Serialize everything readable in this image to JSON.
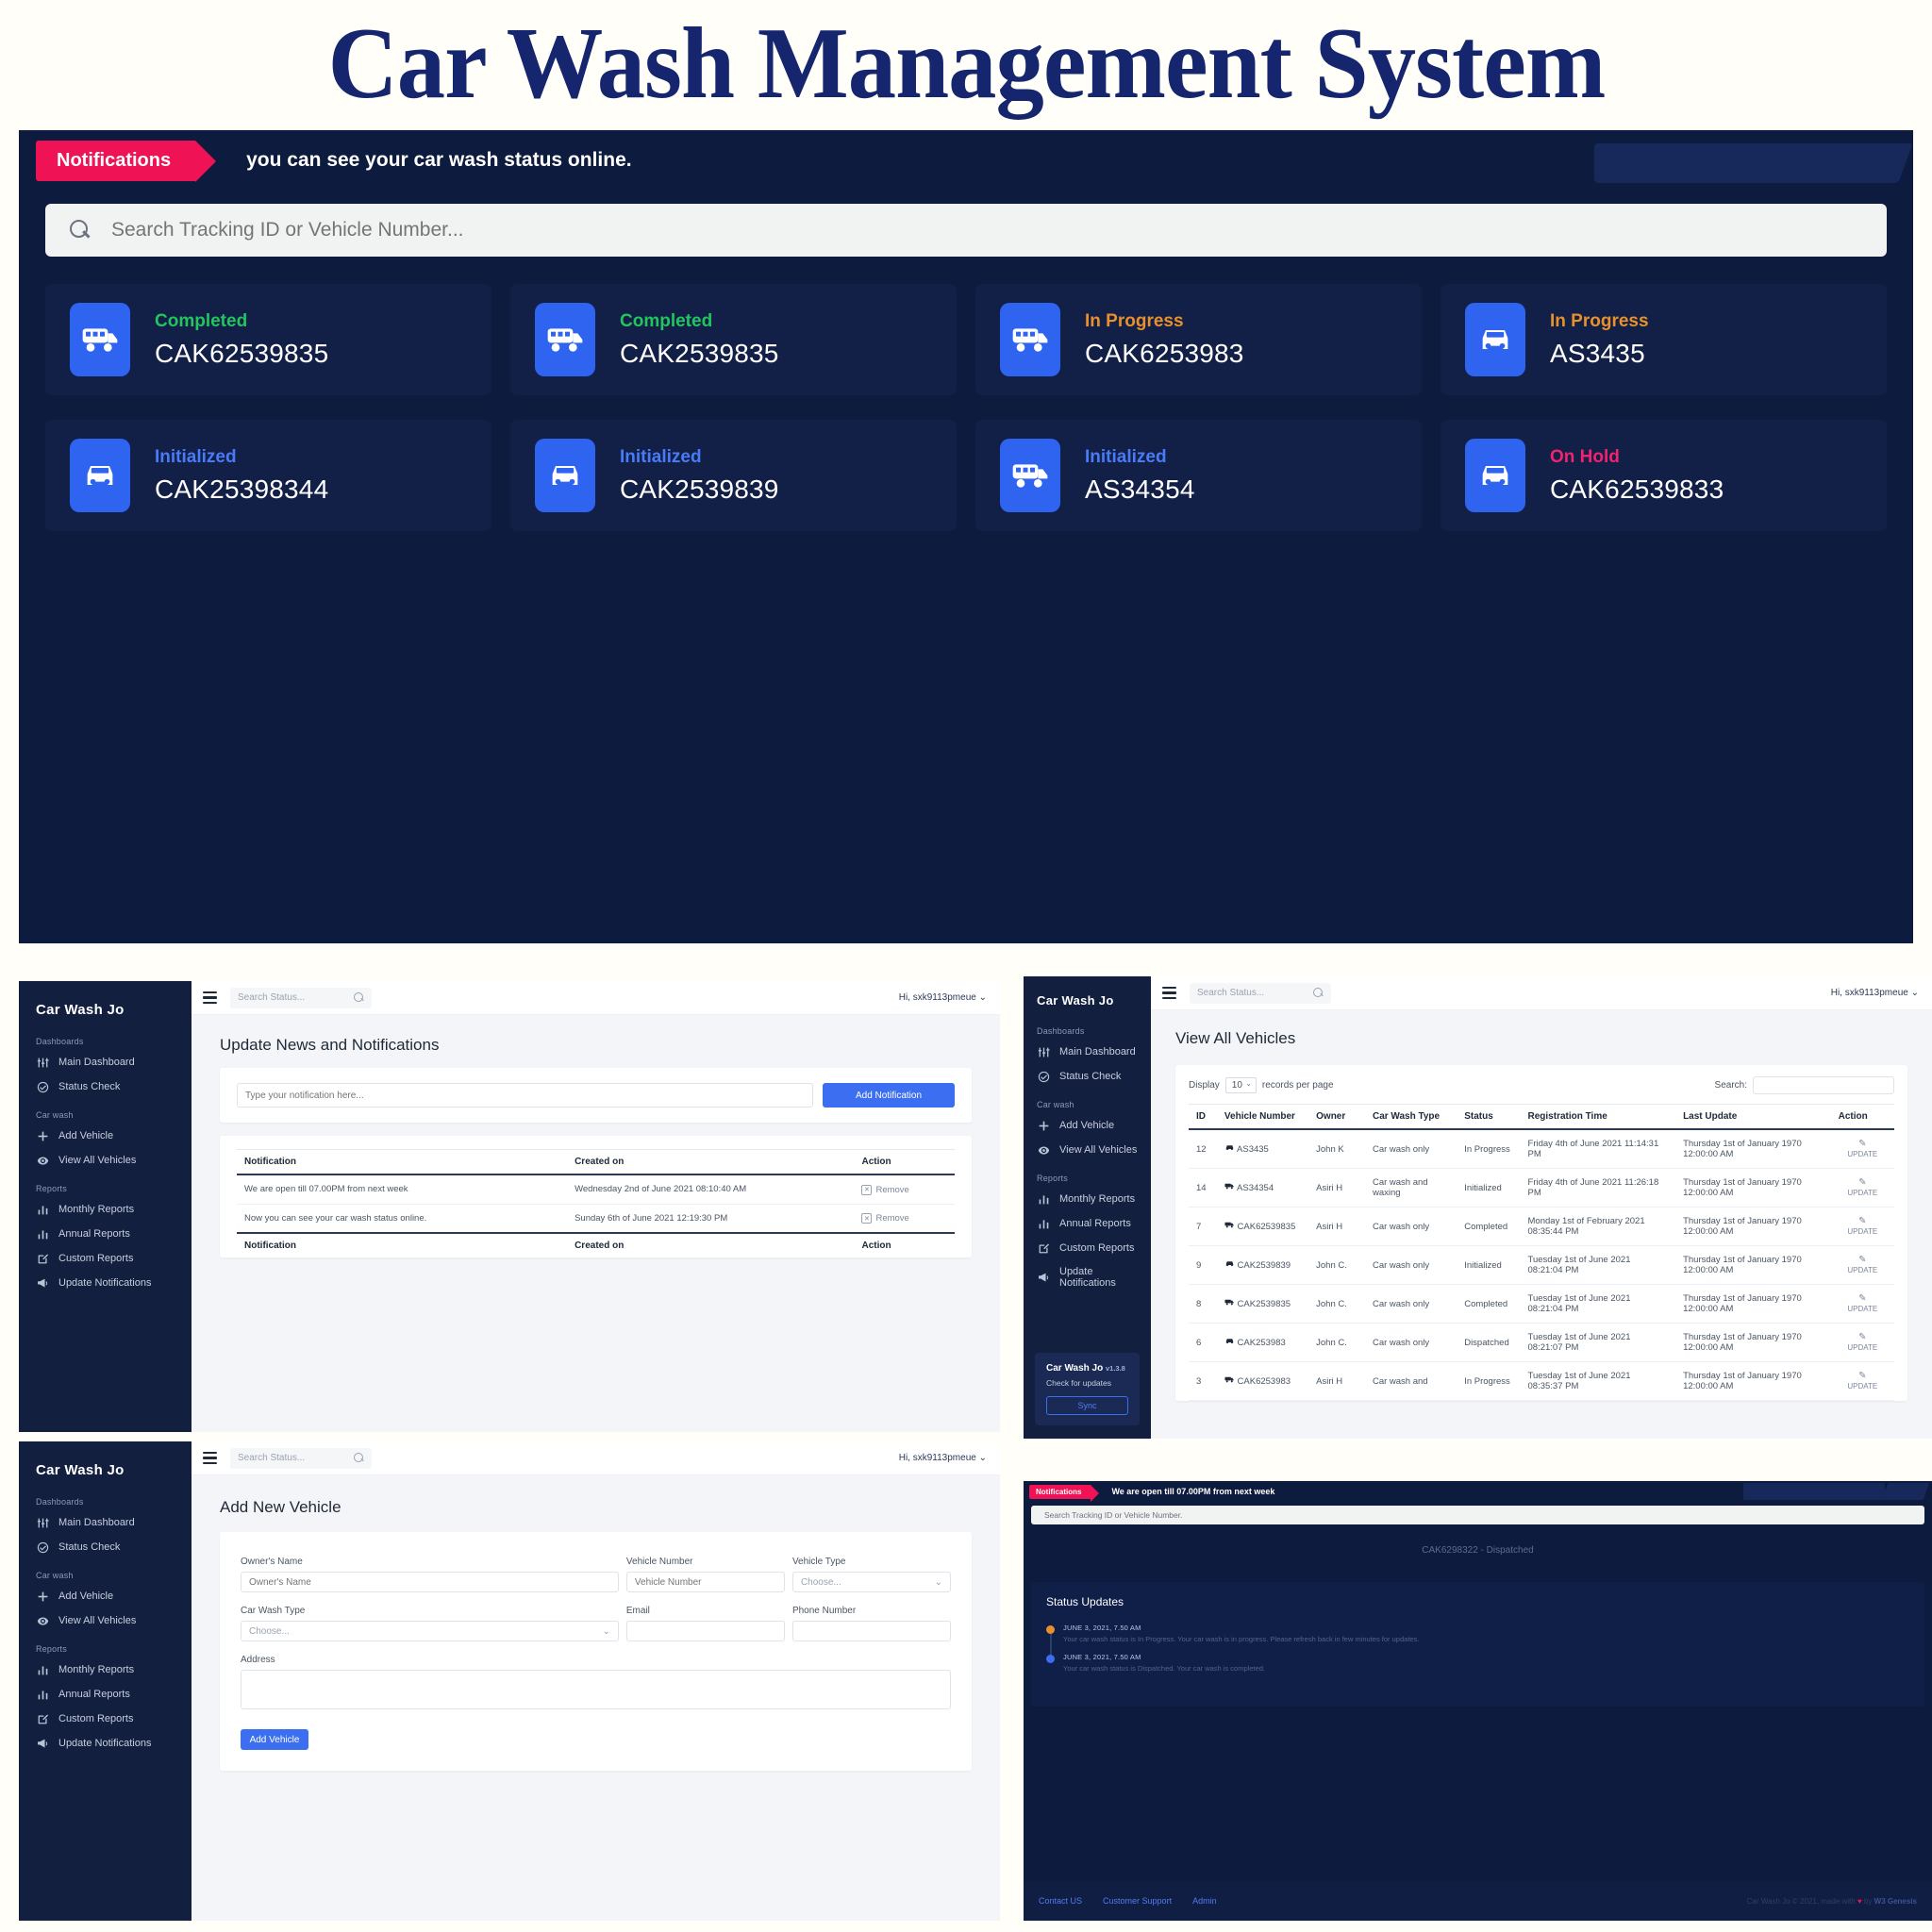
{
  "page_title": "Car Wash Management System",
  "hero": {
    "notification_tag": "Notifications",
    "notification_text": "you can see your car wash status online.",
    "search_placeholder": "Search Tracking ID or Vehicle Number...",
    "cards": [
      {
        "status": "Completed",
        "status_class": "s-completed",
        "tracking_id": "CAK62539835",
        "icon": "van-icon"
      },
      {
        "status": "Completed",
        "status_class": "s-completed",
        "tracking_id": "CAK2539835",
        "icon": "van-icon"
      },
      {
        "status": "In Progress",
        "status_class": "s-inprogress",
        "tracking_id": "CAK6253983",
        "icon": "van-icon"
      },
      {
        "status": "In Progress",
        "status_class": "s-inprogress",
        "tracking_id": "AS3435",
        "icon": "car-icon"
      },
      {
        "status": "Initialized",
        "status_class": "s-initialized",
        "tracking_id": "CAK25398344",
        "icon": "car-icon"
      },
      {
        "status": "Initialized",
        "status_class": "s-initialized",
        "tracking_id": "CAK2539839",
        "icon": "car-icon"
      },
      {
        "status": "Initialized",
        "status_class": "s-initialized",
        "tracking_id": "AS34354",
        "icon": "van-icon"
      },
      {
        "status": "On Hold",
        "status_class": "s-onhold",
        "tracking_id": "CAK62539833",
        "icon": "car-icon"
      }
    ]
  },
  "sidebar": {
    "brand": "Car Wash Jo",
    "groups": [
      {
        "label": "Dashboards",
        "items": [
          {
            "label": "Main Dashboard",
            "icon": "sliders-icon"
          },
          {
            "label": "Status Check",
            "icon": "check-circle-icon"
          }
        ]
      },
      {
        "label": "Car wash",
        "items": [
          {
            "label": "Add Vehicle",
            "icon": "plus-icon"
          },
          {
            "label": "View All Vehicles",
            "icon": "eye-icon"
          }
        ]
      },
      {
        "label": "Reports",
        "items": [
          {
            "label": "Monthly Reports",
            "icon": "bar-chart-icon"
          },
          {
            "label": "Annual Reports",
            "icon": "bar-chart-icon"
          },
          {
            "label": "Custom Reports",
            "icon": "edit-square-icon"
          },
          {
            "label": "Update Notifications",
            "icon": "megaphone-icon"
          }
        ]
      }
    ],
    "version_card": {
      "name": "Car Wash Jo",
      "version": "v1.3.8",
      "subtitle": "Check for updates",
      "sync_label": "Sync"
    }
  },
  "topbar": {
    "search_placeholder": "Search Status...",
    "user_greeting": "Hi, sxk9113pmeue"
  },
  "notifications_page": {
    "title": "Update News and Notifications",
    "input_placeholder": "Type your notification here...",
    "add_button": "Add Notification",
    "columns": [
      "Notification",
      "Created on",
      "Action"
    ],
    "rows": [
      {
        "notification": "We are open till 07.00PM from next week",
        "created_on": "Wednesday 2nd of June 2021 08:10:40 AM",
        "action": "Remove"
      },
      {
        "notification": "Now you can see your car wash status online.",
        "created_on": "Sunday 6th of June 2021 12:19:30 PM",
        "action": "Remove"
      }
    ]
  },
  "vehicles_page": {
    "title": "View All Vehicles",
    "display_label": "Display",
    "records_value": "10",
    "records_label": "records per page",
    "search_label": "Search:",
    "search_value": "",
    "columns": [
      "ID",
      "Vehicle Number",
      "Owner",
      "Car Wash Type",
      "Status",
      "Registration Time",
      "Last Update",
      "Action"
    ],
    "rows": [
      {
        "id": "12",
        "vehicle_icon": "car-icon",
        "vehicle_number": "AS3435",
        "owner": "John K",
        "wash_type": "Car wash only",
        "status": "In Progress",
        "status_class": "s-inprogress",
        "registration": "Friday 4th of June 2021 11:14:31 PM",
        "last_update": "Thursday 1st of January 1970 12:00:00 AM",
        "action": "UPDATE"
      },
      {
        "id": "14",
        "vehicle_icon": "van-icon",
        "vehicle_number": "AS34354",
        "owner": "Asiri H",
        "wash_type": "Car wash and waxing",
        "status": "Initialized",
        "status_class": "s-initialized",
        "registration": "Friday 4th of June 2021 11:26:18 PM",
        "last_update": "Thursday 1st of January 1970 12:00:00 AM",
        "action": "UPDATE"
      },
      {
        "id": "7",
        "vehicle_icon": "van-icon",
        "vehicle_number": "CAK62539835",
        "owner": "Asiri H",
        "wash_type": "Car wash only",
        "status": "Completed",
        "status_class": "s-completed",
        "registration": "Monday 1st of February 2021 08:35:44 PM",
        "last_update": "Thursday 1st of January 1970 12:00:00 AM",
        "action": "UPDATE"
      },
      {
        "id": "9",
        "vehicle_icon": "car-icon",
        "vehicle_number": "CAK2539839",
        "owner": "John C.",
        "wash_type": "Car wash only",
        "status": "Initialized",
        "status_class": "s-initialized",
        "registration": "Tuesday 1st of June 2021 08:21:04 PM",
        "last_update": "Thursday 1st of January 1970 12:00:00 AM",
        "action": "UPDATE"
      },
      {
        "id": "8",
        "vehicle_icon": "van-icon",
        "vehicle_number": "CAK2539835",
        "owner": "John C.",
        "wash_type": "Car wash only",
        "status": "Completed",
        "status_class": "s-completed",
        "registration": "Tuesday 1st of June 2021 08:21:04 PM",
        "last_update": "Thursday 1st of January 1970 12:00:00 AM",
        "action": "UPDATE"
      },
      {
        "id": "6",
        "vehicle_icon": "car-icon",
        "vehicle_number": "CAK253983",
        "owner": "John C.",
        "wash_type": "Car wash only",
        "status": "Dispatched",
        "status_class": "s-dispatched",
        "registration": "Tuesday 1st of June 2021 08:21:07 PM",
        "last_update": "Thursday 1st of January 1970 12:00:00 AM",
        "action": "UPDATE"
      },
      {
        "id": "3",
        "vehicle_icon": "van-icon",
        "vehicle_number": "CAK6253983",
        "owner": "Asiri H",
        "wash_type": "Car wash and",
        "status": "In Progress",
        "status_class": "s-inprogress",
        "registration": "Tuesday 1st of June 2021 08:35:37 PM",
        "last_update": "Thursday 1st of January 1970 12:00:00 AM",
        "action": "UPDATE"
      }
    ]
  },
  "add_vehicle_page": {
    "title": "Add New Vehicle",
    "fields": {
      "owner_name_label": "Owner's Name",
      "owner_name_placeholder": "Owner's Name",
      "vehicle_number_label": "Vehicle Number",
      "vehicle_number_placeholder": "Vehicle Number",
      "vehicle_type_label": "Vehicle Type",
      "vehicle_type_value": "Choose...",
      "car_wash_type_label": "Car Wash Type",
      "car_wash_type_value": "Choose...",
      "email_label": "Email",
      "email_value": "",
      "phone_label": "Phone Number",
      "phone_value": "",
      "address_label": "Address",
      "address_value": ""
    },
    "submit_label": "Add Vehicle"
  },
  "status_page": {
    "notification_tag": "Notifications",
    "notification_text": "We are open till 07.00PM from next week",
    "search_placeholder": "Search Tracking ID or Vehicle Number.",
    "banner": "CAK6298322 - Dispatched",
    "section_title": "Status Updates",
    "timeline": [
      {
        "date": "JUNE 3, 2021, 7.50 AM",
        "desc": "Your car wash status is In Progress. Your car wash is in progress. Please refresh back in few minutes for updates.",
        "dot_color": "#e8912c"
      },
      {
        "date": "JUNE 3, 2021, 7.50 AM",
        "desc": "Your car wash status is Dispatched. Your car wash is completed.",
        "dot_color": "#3b6ef0"
      }
    ],
    "footer_links": [
      "Contact US",
      "Customer Support",
      "Admin"
    ],
    "copyright_prefix": "Car Wash Jo © 2021, made with",
    "copyright_heart": "♥",
    "copyright_mid": "by",
    "copyright_brand": "W3 Genesis"
  }
}
